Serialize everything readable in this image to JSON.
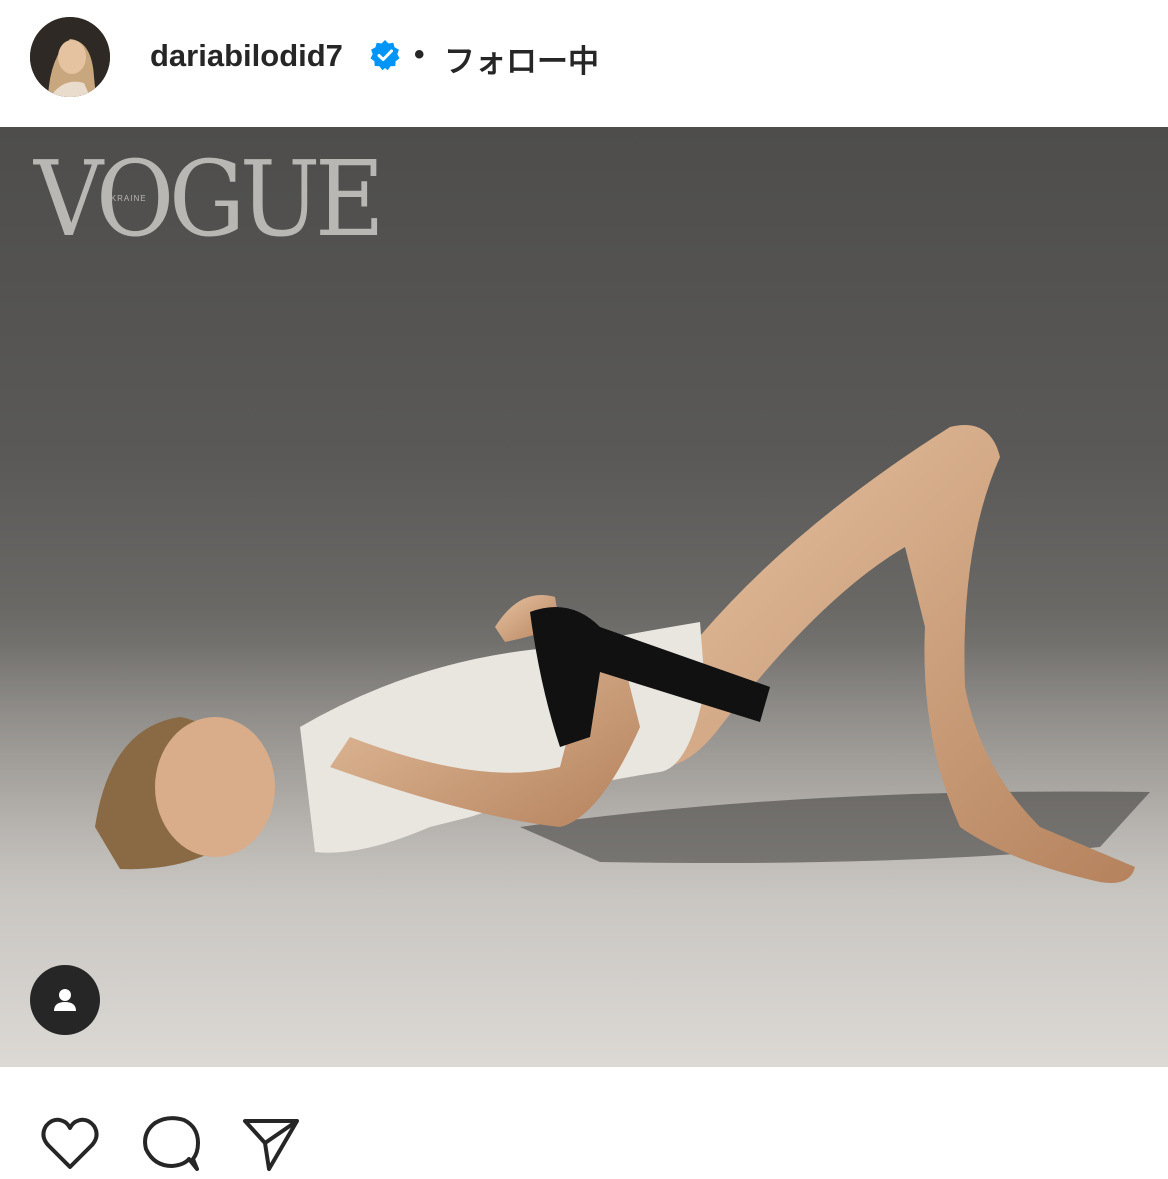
{
  "header": {
    "username": "dariabilodid7",
    "separator": "•",
    "follow_status": "フォロー中"
  },
  "post": {
    "magazine_logo": "VOGUE",
    "magazine_edition": "UKRAINE"
  },
  "actions": {
    "like": "heart-icon",
    "comment": "comment-icon",
    "share": "send-icon"
  },
  "colors": {
    "verified": "#0095f6",
    "text": "#262626"
  }
}
